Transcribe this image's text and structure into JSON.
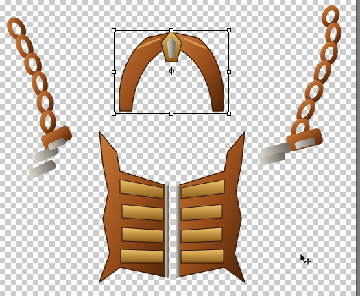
{
  "document": {
    "background": "transparent-checkerboard",
    "layer_objects": [
      "chain-left",
      "chain-right",
      "collar-piece",
      "breastplate"
    ]
  },
  "colors": {
    "copper": "#a55a22",
    "copper_dark": "#5a2a0c",
    "gold": "#d8a64a",
    "silver": "#a9a39a",
    "checker": "#cccccc"
  },
  "transform_tool": {
    "active": true,
    "handles": 8,
    "pivot": "center"
  },
  "cursor": {
    "type": "move-cursor"
  }
}
